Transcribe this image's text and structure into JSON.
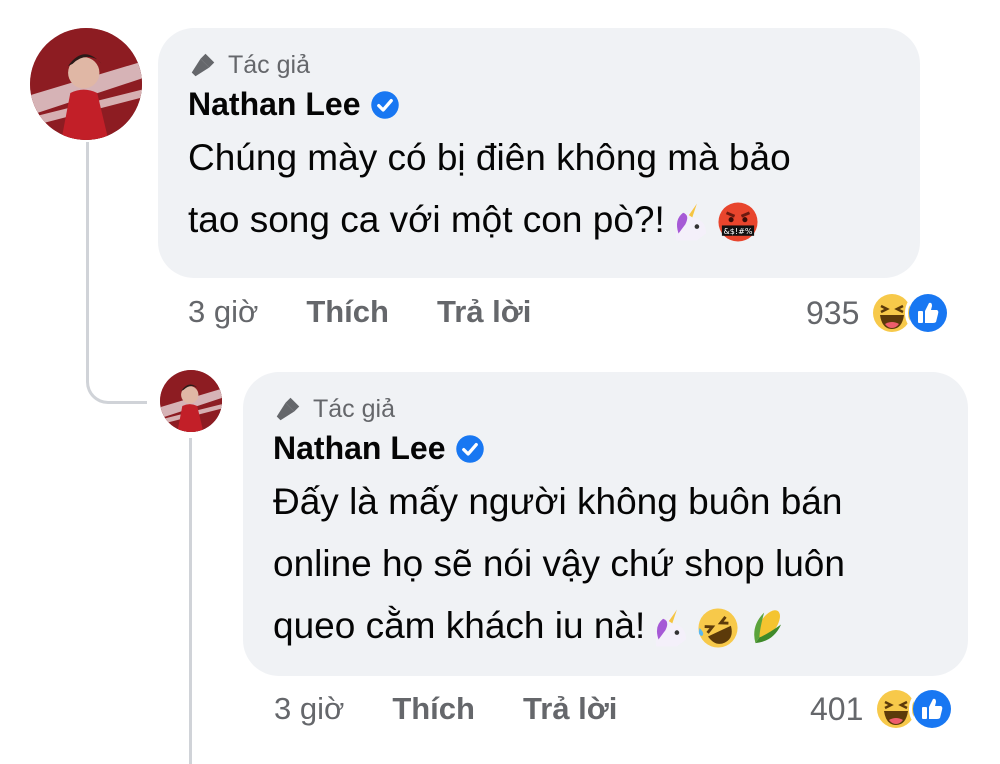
{
  "comments": [
    {
      "author_tag": "Tác giả",
      "name": "Nathan Lee",
      "text_line1": "Chúng mày có bị điên không mà bảo",
      "text_line2": "tao song ca với một con pò?!",
      "emojis": [
        "unicorn-emoji",
        "swearing-face-emoji"
      ],
      "time": "3 giờ",
      "like_label": "Thích",
      "reply_label": "Trả lời",
      "reaction_count": "935",
      "reactions": [
        "haha-reaction",
        "like-reaction"
      ]
    },
    {
      "author_tag": "Tác giả",
      "name": "Nathan Lee",
      "text_line1": "Đấy là mấy người không buôn bán",
      "text_line2": "online họ sẽ nói vậy chứ shop luôn",
      "text_line3": "queo cằm khách iu nà!",
      "emojis": [
        "unicorn-emoji",
        "rofl-emoji",
        "corn-emoji"
      ],
      "time": "3 giờ",
      "like_label": "Thích",
      "reply_label": "Trả lời",
      "reaction_count": "401",
      "reactions": [
        "haha-reaction",
        "like-reaction"
      ]
    }
  ],
  "colors": {
    "bubble": "#f0f2f5",
    "meta_text": "#65676b",
    "verified": "#1877f2",
    "thread_line": "#d0d3d8"
  }
}
